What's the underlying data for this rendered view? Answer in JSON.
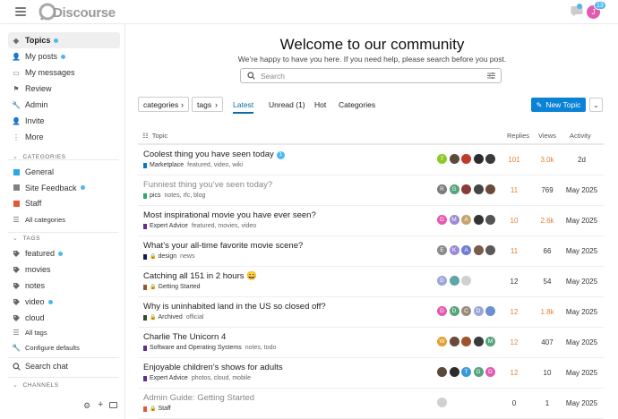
{
  "header": {
    "logo_text": "Discourse",
    "notification_count": "13",
    "avatar_letter": "J"
  },
  "sidebar": {
    "top_items": [
      {
        "label": "Topics",
        "icon": "layers-icon",
        "unread": true
      },
      {
        "label": "My posts",
        "icon": "user-icon",
        "unread": true
      },
      {
        "label": "My messages",
        "icon": "inbox-icon",
        "unread": false
      },
      {
        "label": "Review",
        "icon": "flag-icon",
        "unread": false
      },
      {
        "label": "Admin",
        "icon": "wrench-icon",
        "unread": false
      },
      {
        "label": "Invite",
        "icon": "user-plus-icon",
        "unread": false
      },
      {
        "label": "More",
        "icon": "ellipsis-icon",
        "unread": false
      }
    ],
    "categories_heading": "CATEGORIES",
    "categories": [
      {
        "label": "General",
        "color": "#25aae1",
        "unread": false
      },
      {
        "label": "Site Feedback",
        "color": "#808281",
        "unread": true
      },
      {
        "label": "Staff",
        "color": "#e45735",
        "unread": false
      }
    ],
    "all_categories": "All categories",
    "tags_heading": "TAGS",
    "tags": [
      {
        "label": "featured",
        "unread": true
      },
      {
        "label": "movies",
        "unread": false
      },
      {
        "label": "notes",
        "unread": false
      },
      {
        "label": "video",
        "unread": true
      },
      {
        "label": "cloud",
        "unread": false
      }
    ],
    "all_tags": "All tags",
    "configure_defaults": "Configure defaults",
    "search_chat": "Search chat",
    "channels_heading": "CHANNELS"
  },
  "welcome": {
    "title": "Welcome to our community",
    "subtitle": "We’re happy to have you here. If you need help, please search before you post.",
    "search_placeholder": "Search"
  },
  "nav": {
    "categories_dropdown": "categories",
    "tags_dropdown": "tags",
    "tabs": [
      "Latest",
      "Unread (1)",
      "Hot",
      "Categories"
    ],
    "active_tab": "Latest",
    "new_topic": "New Topic"
  },
  "table": {
    "headers": {
      "topic": "Topic",
      "replies": "Replies",
      "views": "Views",
      "activity": "Activity"
    },
    "rows": [
      {
        "title": "Coolest thing you have seen today",
        "new_count": "1",
        "visited": false,
        "category": "Marketplace",
        "cat_color": "#0e76bd",
        "locked": false,
        "tags": "featured, video, wiki",
        "posters": [
          {
            "c": "#8ac926",
            "l": "T"
          },
          {
            "c": "#5a4a3a",
            "l": ""
          },
          {
            "c": "#c0392b",
            "l": ""
          },
          {
            "c": "#2c2c2c",
            "l": ""
          },
          {
            "c": "#3a3a3a",
            "l": ""
          }
        ],
        "replies": "101",
        "replies_color": "#e3823b",
        "views": "3.0k",
        "views_color": "#e3823b",
        "activity": "2d"
      },
      {
        "title": "Funniest thing you’ve seen today?",
        "new_count": "",
        "visited": true,
        "category": "pics",
        "cat_color": "#27ae60",
        "locked": false,
        "tags": "notes, rfc, blog",
        "posters": [
          {
            "c": "#7b7b7b",
            "l": "R"
          },
          {
            "c": "#56a37c",
            "l": "G"
          },
          {
            "c": "#8b3a3a",
            "l": ""
          },
          {
            "c": "#444",
            "l": ""
          },
          {
            "c": "#6b4a3a",
            "l": ""
          }
        ],
        "replies": "11",
        "replies_color": "#e3823b",
        "views": "769",
        "views_color": "#333333",
        "activity": "May 2025"
      },
      {
        "title": "Most inspirational movie you have ever seen?",
        "new_count": "",
        "visited": false,
        "category": "Expert Advice",
        "cat_color": "#652d90",
        "locked": false,
        "tags": "featured, movies, video",
        "posters": [
          {
            "c": "#e45ab1",
            "l": "D"
          },
          {
            "c": "#9b8bd6",
            "l": "M"
          },
          {
            "c": "#c5a36a",
            "l": "A"
          },
          {
            "c": "#333",
            "l": ""
          },
          {
            "c": "#555",
            "l": ""
          }
        ],
        "replies": "10",
        "replies_color": "#e3823b",
        "views": "2.6k",
        "views_color": "#e3823b",
        "activity": "May 2025"
      },
      {
        "title": "What’s your all-time favorite movie scene?",
        "new_count": "",
        "visited": false,
        "category": "design",
        "cat_color": "#1b1b4d",
        "locked": true,
        "tags": "news",
        "posters": [
          {
            "c": "#8a8a8a",
            "l": "E"
          },
          {
            "c": "#9b8bd6",
            "l": "K"
          },
          {
            "c": "#6c7fd1",
            "l": "A"
          },
          {
            "c": "#7a5a4a",
            "l": ""
          },
          {
            "c": "#5a5a5a",
            "l": ""
          }
        ],
        "replies": "11",
        "replies_color": "#e3823b",
        "views": "66",
        "views_color": "#333333",
        "activity": "May 2025"
      },
      {
        "title": "Catching all 151 in 2 hours 😀",
        "new_count": "",
        "visited": false,
        "category": "Getting Started",
        "cat_color": "#a0522d",
        "locked": true,
        "tags": "",
        "posters": [
          {
            "c": "#9ba6d9",
            "l": "D"
          },
          {
            "c": "#5fa5a5",
            "l": ""
          },
          {
            "c": "#d0d0d0",
            "l": ""
          }
        ],
        "replies": "12",
        "replies_color": "#333333",
        "views": "54",
        "views_color": "#333333",
        "activity": "May 2025"
      },
      {
        "title": "Why is uninhabited land in the US so closed off?",
        "new_count": "",
        "visited": false,
        "category": "Archived",
        "cat_color": "#2d4d2d",
        "locked": true,
        "tags": "official",
        "posters": [
          {
            "c": "#e45ab1",
            "l": "D"
          },
          {
            "c": "#56a37c",
            "l": "D"
          },
          {
            "c": "#9b8b7b",
            "l": "C"
          },
          {
            "c": "#9ba6d9",
            "l": "D"
          },
          {
            "c": "#6c8fd1",
            "l": ""
          }
        ],
        "replies": "12",
        "replies_color": "#e3823b",
        "views": "1.8k",
        "views_color": "#e3823b",
        "activity": "May 2025"
      },
      {
        "title": "Charlie The Unicorn 4",
        "new_count": "",
        "visited": false,
        "category": "Software and Operating Systems",
        "cat_color": "#652d90",
        "locked": false,
        "tags": "notes, todo",
        "posters": [
          {
            "c": "#e3a035",
            "l": "W"
          },
          {
            "c": "#6b4a3a",
            "l": ""
          },
          {
            "c": "#a0522d",
            "l": ""
          },
          {
            "c": "#3a3a3a",
            "l": ""
          },
          {
            "c": "#56a37c",
            "l": "M"
          }
        ],
        "replies": "12",
        "replies_color": "#e3823b",
        "views": "407",
        "views_color": "#333333",
        "activity": "May 2025"
      },
      {
        "title": "Enjoyable children’s shows for adults",
        "new_count": "",
        "visited": false,
        "category": "Expert Advice",
        "cat_color": "#652d90",
        "locked": false,
        "tags": "photos, cloud, mobile",
        "posters": [
          {
            "c": "#5a4a3a",
            "l": ""
          },
          {
            "c": "#2c2c2c",
            "l": ""
          },
          {
            "c": "#3a9ad9",
            "l": "T"
          },
          {
            "c": "#56a37c",
            "l": "G"
          },
          {
            "c": "#e45ab1",
            "l": "D"
          }
        ],
        "replies": "12",
        "replies_color": "#e3823b",
        "views": "10",
        "views_color": "#333333",
        "activity": "May 2025"
      },
      {
        "title": "Admin Guide: Getting Started",
        "new_count": "",
        "visited": true,
        "category": "Staff",
        "cat_color": "#e45735",
        "locked": true,
        "tags": "",
        "posters": [
          {
            "c": "#d0d0d0",
            "l": ""
          }
        ],
        "replies": "0",
        "replies_color": "#333333",
        "views": "1",
        "views_color": "#333333",
        "activity": "May 2025"
      }
    ]
  }
}
